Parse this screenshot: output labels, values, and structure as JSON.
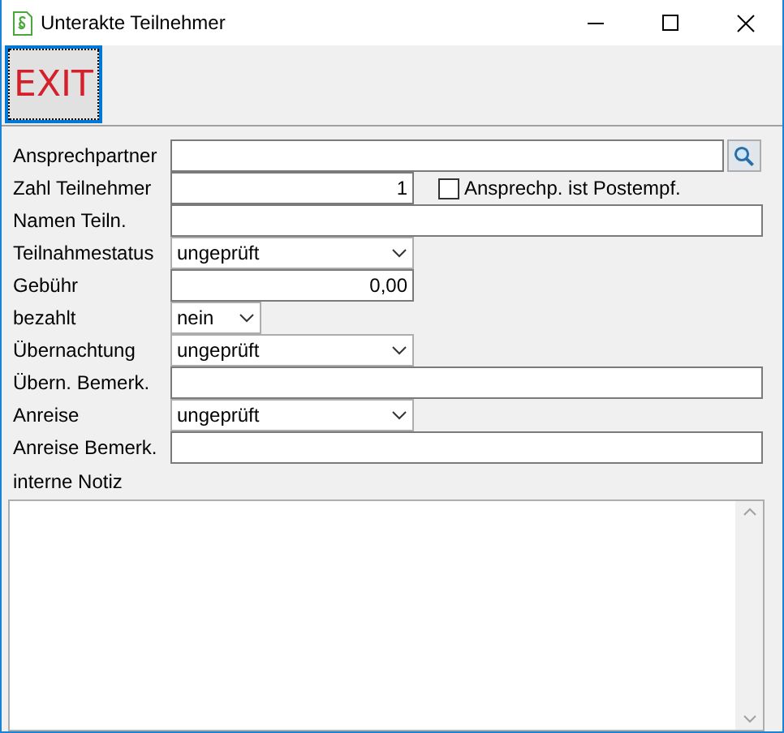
{
  "window": {
    "title": "Unterakte Teilnehmer"
  },
  "toolbar": {
    "exit_button": "EXIT"
  },
  "fields": [
    {
      "label": "Ansprechpartner",
      "kind": "search"
    },
    {
      "label": "Zahl Teilnehmer",
      "kind": "number",
      "value": "1",
      "checkbox": {
        "label": "Ansprechp. ist Postempf.",
        "checked": false
      }
    },
    {
      "label": "Namen Teiln.",
      "kind": "text"
    },
    {
      "label": "Teilnahmestatus",
      "kind": "select",
      "value": "ungeprüft"
    },
    {
      "label": "Gebühr",
      "kind": "number",
      "value": "0,00"
    },
    {
      "label": "bezahlt",
      "kind": "short-select",
      "value": "nein"
    },
    {
      "label": "Übernachtung",
      "kind": "select",
      "value": "ungeprüft"
    },
    {
      "label": "Übern. Bemerk.",
      "kind": "text"
    },
    {
      "label": "Anreise",
      "kind": "select",
      "value": "ungeprüft"
    },
    {
      "label": "Anreise Bemerk.",
      "kind": "text"
    }
  ],
  "notes": {
    "label": "interne Notiz"
  }
}
